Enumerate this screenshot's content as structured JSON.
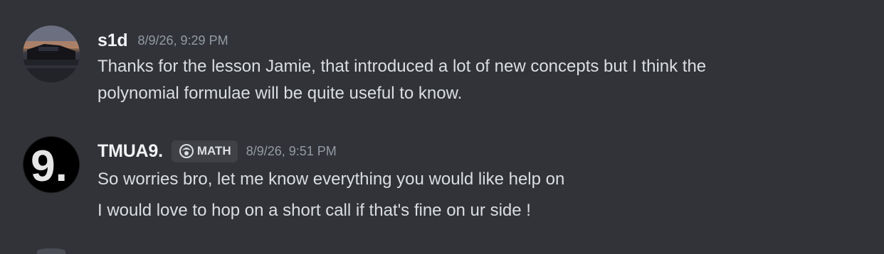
{
  "chat": {
    "messages": [
      {
        "username": "s1d",
        "timestamp": "8/9/26, 9:29 PM",
        "avatar_icon": "profile-photo-car",
        "lines": [
          "Thanks for the lesson Jamie, that introduced a lot of new concepts but I think the",
          "polynomial formulae will be quite useful to know."
        ]
      },
      {
        "username": "TMUA9.",
        "tag_label": "MATH",
        "tag_icon": "server-tag-icon",
        "timestamp": "8/9/26, 9:51 PM",
        "avatar_text": "9.",
        "lines": [
          "So worries bro, let me know everything you would like help on",
          "I would love to hop on a short call if that's fine on ur side !"
        ]
      }
    ]
  },
  "colors": {
    "background": "#313338",
    "username": "#f2f3f5",
    "text": "#dbdee1",
    "timestamp": "#949ba4",
    "tag_background": "#3f4147"
  }
}
